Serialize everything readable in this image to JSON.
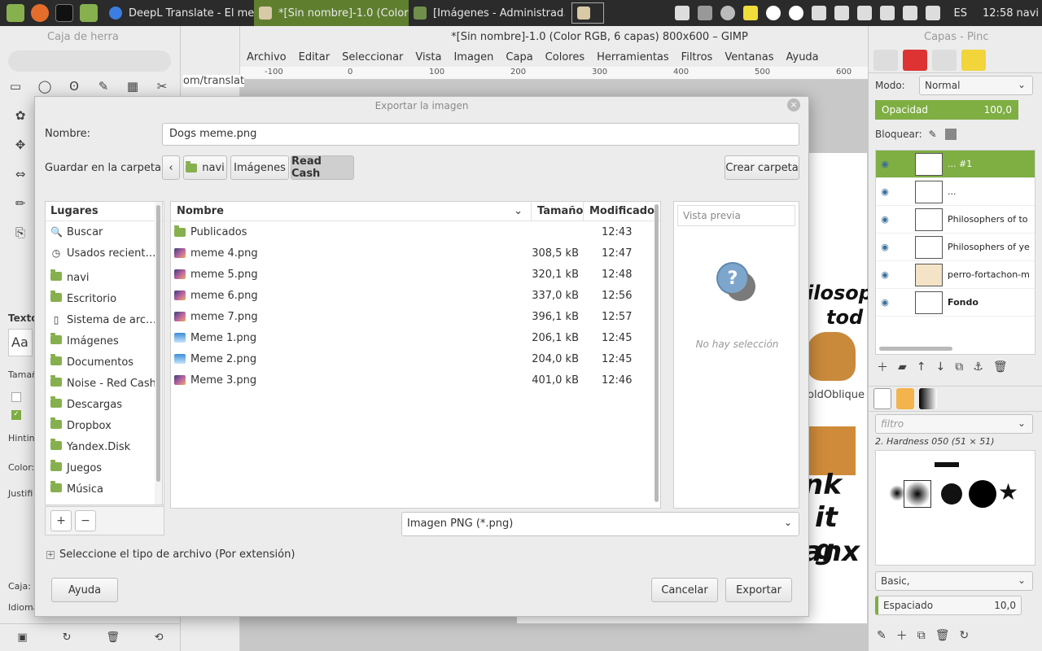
{
  "taskbar": {
    "tasks": [
      {
        "label": "DeepL Translate - El mej…"
      },
      {
        "label": "*[Sin nombre]-1.0 (Color …",
        "active": true
      },
      {
        "label": "[Imágenes - Administrad…"
      }
    ],
    "keyboard": "ES",
    "time": "12:58",
    "user": "navi"
  },
  "toolbox": {
    "title": "Caja de herra",
    "labels": {
      "texto": "Texto",
      "tam": "Tamaño",
      "hinting": "Hintin",
      "color": "Color:",
      "justif": "Justifi",
      "caja": "Caja:",
      "idioma": "Idioma",
      "aa": "Aa"
    }
  },
  "gimp": {
    "title": "*[Sin nombre]-1.0 (Color RGB, 6 capas) 800x600 – GIMP",
    "menu": [
      "Archivo",
      "Editar",
      "Seleccionar",
      "Vista",
      "Imagen",
      "Capa",
      "Colores",
      "Herramientas",
      "Filtros",
      "Ventanas",
      "Ayuda"
    ],
    "ruler": [
      "-100",
      "0",
      "100",
      "200",
      "300",
      "400",
      "500",
      "600"
    ],
    "url_fragment": "om/translat",
    "canvas_text": [
      "ilosop",
      "tod",
      "oldOblique",
      "nk",
      "it g",
      "anx"
    ]
  },
  "dock": {
    "title": "Capas - Pinc",
    "mode_label": "Modo:",
    "mode_value": "Normal",
    "opacity_label": "Opacidad",
    "opacity_value": "100,0",
    "lock_label": "Bloquear:",
    "layers": [
      {
        "name": "... #1",
        "selected": true
      },
      {
        "name": "..."
      },
      {
        "name": "Philosophers of to"
      },
      {
        "name": "Philosophers of ye"
      },
      {
        "name": "perro-fortachon-m"
      },
      {
        "name": "Fondo",
        "bold": true
      }
    ],
    "filter_placeholder": "filtro",
    "brush_name": "2. Hardness 050 (51 × 51)",
    "brush_preset": "Basic,",
    "spacing_label": "Espaciado",
    "spacing_value": "10,0"
  },
  "dialog": {
    "title": "Exportar la imagen",
    "name_label": "Nombre:",
    "name_value": "Dogs meme.png",
    "folder_label": "Guardar en la carpeta:",
    "path": [
      "navi",
      "Imágenes",
      "Read Cash"
    ],
    "create_folder": "Crear carpeta",
    "places_header": "Lugares",
    "places": [
      {
        "label": "Buscar",
        "icon": "search-icon"
      },
      {
        "label": "Usados recient…",
        "icon": "clock-icon"
      },
      {
        "label": "navi",
        "icon": "home-folder-icon"
      },
      {
        "label": "Escritorio",
        "icon": "folder-icon"
      },
      {
        "label": "Sistema de arc…",
        "icon": "drive-icon"
      },
      {
        "label": "Imágenes",
        "icon": "folder-icon"
      },
      {
        "label": "Documentos",
        "icon": "folder-icon"
      },
      {
        "label": "Noise - Red Cash",
        "icon": "folder-icon"
      },
      {
        "label": "Descargas",
        "icon": "folder-icon"
      },
      {
        "label": "Dropbox",
        "icon": "folder-icon"
      },
      {
        "label": "Yandex.Disk",
        "icon": "folder-icon"
      },
      {
        "label": "Juegos",
        "icon": "folder-icon"
      },
      {
        "label": "Música",
        "icon": "folder-icon"
      }
    ],
    "columns": {
      "name": "Nombre",
      "size": "Tamaño",
      "modified": "Modificado"
    },
    "files": [
      {
        "name": "Publicados",
        "size": "",
        "modified": "12:43",
        "type": "folder"
      },
      {
        "name": "meme 4.png",
        "size": "308,5 kB",
        "modified": "12:47",
        "type": "image"
      },
      {
        "name": "meme 5.png",
        "size": "320,1 kB",
        "modified": "12:48",
        "type": "image"
      },
      {
        "name": "meme 6.png",
        "size": "337,0 kB",
        "modified": "12:56",
        "type": "image"
      },
      {
        "name": "meme 7.png",
        "size": "396,1 kB",
        "modified": "12:57",
        "type": "image"
      },
      {
        "name": "Meme 1.png",
        "size": "206,1 kB",
        "modified": "12:45",
        "type": "image-blue"
      },
      {
        "name": "Meme 2.png",
        "size": "204,0 kB",
        "modified": "12:45",
        "type": "image-blue"
      },
      {
        "name": "Meme 3.png",
        "size": "401,0 kB",
        "modified": "12:46",
        "type": "image"
      }
    ],
    "preview_label": "Vista previa",
    "preview_empty": "No hay selección",
    "file_type": "Imagen PNG (*.png)",
    "expander": "Seleccione el tipo de archivo (Por extensión)",
    "help": "Ayuda",
    "cancel": "Cancelar",
    "export": "Exportar"
  }
}
